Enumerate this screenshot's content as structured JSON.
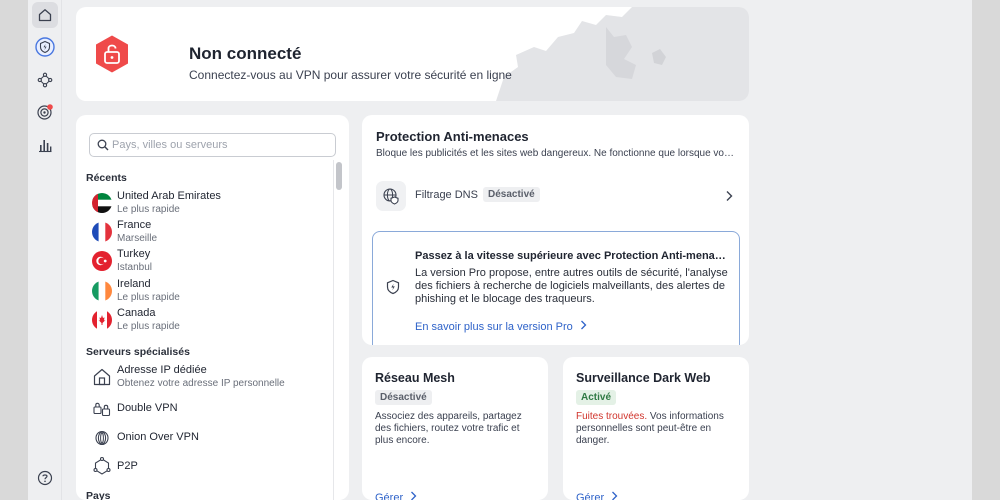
{
  "colors": {
    "accent": "#2f63c9",
    "danger": "#ef4a4a",
    "success": "#2f7a44",
    "window_bg": "#eeeff1",
    "card_bg": "#ffffff"
  },
  "rail": {
    "items": [
      {
        "icon": "home-icon",
        "active": true
      },
      {
        "icon": "shield-bolt-icon",
        "active": false
      },
      {
        "icon": "mesh-network-icon",
        "active": false
      },
      {
        "icon": "dark-web-target-icon",
        "active": false
      },
      {
        "icon": "stats-bars-icon",
        "active": false
      },
      {
        "icon": "help-icon",
        "active": false
      }
    ]
  },
  "status": {
    "title": "Non connecté",
    "subtitle": "Connectez-vous au VPN pour assurer votre sécurité en ligne",
    "icon": "unlocked-padlock-icon"
  },
  "search": {
    "placeholder": "Pays, villes ou serveurs",
    "value": ""
  },
  "recents": {
    "heading": "Récents",
    "items": [
      {
        "country": "United Arab Emirates",
        "detail": "Le plus rapide",
        "flag": "uae-flag"
      },
      {
        "country": "France",
        "detail": "Marseille",
        "flag": "france-flag"
      },
      {
        "country": "Turkey",
        "detail": "Istanbul",
        "flag": "turkey-flag"
      },
      {
        "country": "Ireland",
        "detail": "Le plus rapide",
        "flag": "ireland-flag"
      },
      {
        "country": "Canada",
        "detail": "Le plus rapide",
        "flag": "canada-flag"
      }
    ]
  },
  "specialty": {
    "heading": "Serveurs spécialisés",
    "items": [
      {
        "title": "Adresse IP dédiée",
        "detail": "Obtenez votre adresse IP personnelle",
        "icon": "dedicated-ip-icon"
      },
      {
        "title": "Double VPN",
        "detail": "",
        "icon": "double-vpn-icon"
      },
      {
        "title": "Onion Over VPN",
        "detail": "",
        "icon": "onion-icon"
      },
      {
        "title": "P2P",
        "detail": "",
        "icon": "p2p-icon"
      }
    ]
  },
  "countries": {
    "heading": "Pays"
  },
  "threat": {
    "title": "Protection Anti-menaces",
    "description": "Bloque les publicités et les sites web dangereux. Ne fonctionne que lorsque vous êt...",
    "dns": {
      "label": "Filtrage DNS",
      "badge": "Désactivé",
      "icon": "globe-shield-icon"
    },
    "promo": {
      "title": "Passez à la vitesse supérieure avec Protection Anti-menace...",
      "body": "La version Pro propose, entre autres outils de sécurité, l'analyse des fichiers à recherche de logiciels malveillants, des alertes de phishing et le blocage des traqueurs.",
      "link": "En savoir plus sur la version Pro",
      "icon": "shield-bolt-icon"
    }
  },
  "mesh": {
    "title": "Réseau Mesh",
    "badge": "Désactivé",
    "description": "Associez des appareils, partagez des fichiers, routez votre trafic et plus encore.",
    "link": "Gérer"
  },
  "darkweb": {
    "title": "Surveillance Dark Web",
    "badge": "Activé",
    "warning": "Fuites trouvées.",
    "description": " Vos informations personnelles sont peut-être en danger.",
    "link": "Gérer"
  }
}
